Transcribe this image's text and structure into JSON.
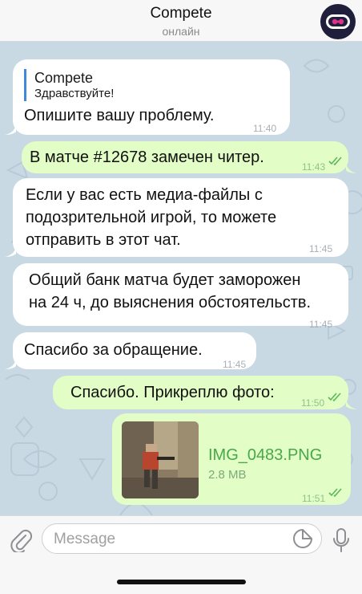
{
  "header": {
    "title": "Compete",
    "status": "онлайн",
    "avatar_icon": "logo-icon"
  },
  "messages": [
    {
      "direction": "incoming",
      "reply": {
        "name": "Compete",
        "text": "Здравствуйте!"
      },
      "text": "Опишите вашу проблему.",
      "time": "11:40"
    },
    {
      "direction": "outgoing",
      "text": "В матче #12678 замечен читер.",
      "time": "11:43",
      "read": true
    },
    {
      "direction": "incoming",
      "lines": [
        "Если у вас есть медиа-файлы с",
        "подозрительной игрой, то можете",
        "отправить в этот чат."
      ],
      "time": "11:45"
    },
    {
      "direction": "incoming",
      "lines": [
        "Общий банк матча будет заморожен",
        "на 24 ч, до выяснения обстоятельств."
      ],
      "time": "11:45"
    },
    {
      "direction": "incoming",
      "text": "Спасибо за обращение.",
      "time": "11:45"
    },
    {
      "direction": "outgoing",
      "text": "Спасибо. Прикреплю фото:",
      "time": "11:50",
      "read": true
    },
    {
      "direction": "outgoing",
      "file": {
        "name": "IMG_0483.PNG",
        "size": "2.8 MB"
      },
      "time": "11:51",
      "read": true
    }
  ],
  "input": {
    "placeholder": "Message",
    "attach_icon": "paperclip-icon",
    "sticker_icon": "sticker-icon",
    "mic_icon": "microphone-icon"
  },
  "colors": {
    "chat_background": "#c9d9e4",
    "incoming_bubble": "#ffffff",
    "outgoing_bubble": "#e2fdc5",
    "file_name": "#4aa74a",
    "reply_bar": "#3e8ad9"
  }
}
